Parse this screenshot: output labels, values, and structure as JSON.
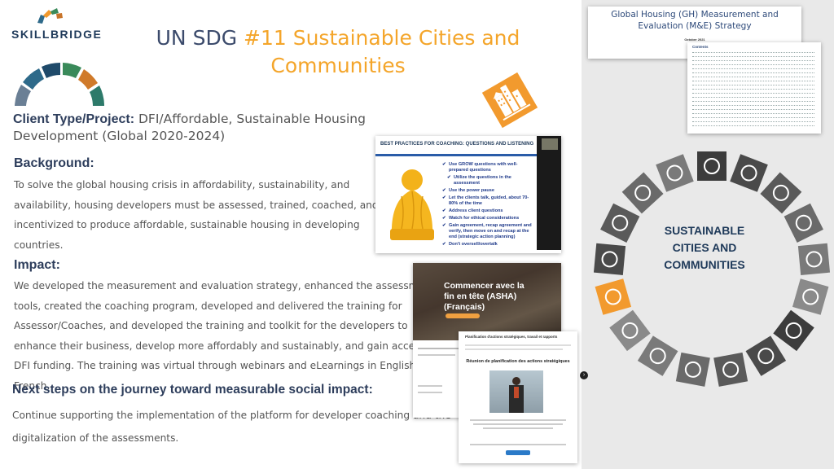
{
  "brand": {
    "logo_text": "SKILLBRIDGE"
  },
  "title": {
    "line1_prefix": "UN SDG ",
    "line1_highlight": "#11 Sustainable Cities and",
    "line2": "Communities"
  },
  "client": {
    "label": "Client Type/Project:",
    "value": " DFI/Affordable, Sustainable Housing Development (Global 2020-2024)"
  },
  "background": {
    "heading": "Background:",
    "lines": [
      "To solve the global housing crisis in affordability, sustainability, and",
      "availability, housing developers must be assessed, trained, coached, and",
      "incentivized to produce affordable, sustainable housing in developing",
      "countries."
    ]
  },
  "impact": {
    "heading": "Impact:",
    "lines": [
      "We developed the measurement and evaluation strategy, enhanced the assessment",
      "tools, created the coaching program, developed and delivered the training for",
      "Assessor/Coaches, and developed the training and toolkit for the developers to",
      "enhance their business, develop more affordably and sustainably, and gain access to",
      "DFI funding. The training was virtual through webinars and eLearnings in English and",
      "French."
    ]
  },
  "next_steps": {
    "heading": "Next steps on the journey toward measurable social impact:",
    "lines": [
      "Continue supporting the implementation of the platform for developer coaching and the",
      "digitalization of the assessments."
    ]
  },
  "coaching_slide": {
    "title": "BEST PRACTICES FOR COACHING: QUESTIONS AND LISTENING",
    "items": [
      {
        "text": "Use GROW questions with well-prepared questions",
        "sub": false
      },
      {
        "text": "Utilize the questions in the assessment",
        "sub": true
      },
      {
        "text": "Use the power pause",
        "sub": false
      },
      {
        "text": "Let the clients talk, guided, about 70-80% of the time",
        "sub": false
      },
      {
        "text": "Address client questions",
        "sub": false
      },
      {
        "text": "Watch for ethical considerations",
        "sub": false
      },
      {
        "text": "Gain agreement, recap agreement and verify, then move on and recap at the end (strategic action planning)",
        "sub": false
      },
      {
        "text": "Don't oversell/overtalk",
        "sub": false
      }
    ]
  },
  "french_course": {
    "title": "Commencer avec la fin en tête (ASHA) (Français)"
  },
  "planning_page": {
    "top_heading": "Planification d'actions stratégiques, travail et rapports",
    "card_title": "Réunion de planification des actions stratégiques"
  },
  "gh_doc": {
    "title": "Global Housing (GH) Measurement and Evaluation (M&E) Strategy",
    "date": "October 2021",
    "toc_title": "Contents"
  },
  "sdg_wheel": {
    "center_line1": "SUSTAINABLE",
    "center_line2": "CITIES AND",
    "center_line3": "COMMUNITIES",
    "highlight_color": "#f29a2e",
    "segment_color": "#555555"
  },
  "colors": {
    "title_dark": "#3b4a6b",
    "title_accent": "#f4a52a",
    "heading": "#2e3e5c"
  }
}
